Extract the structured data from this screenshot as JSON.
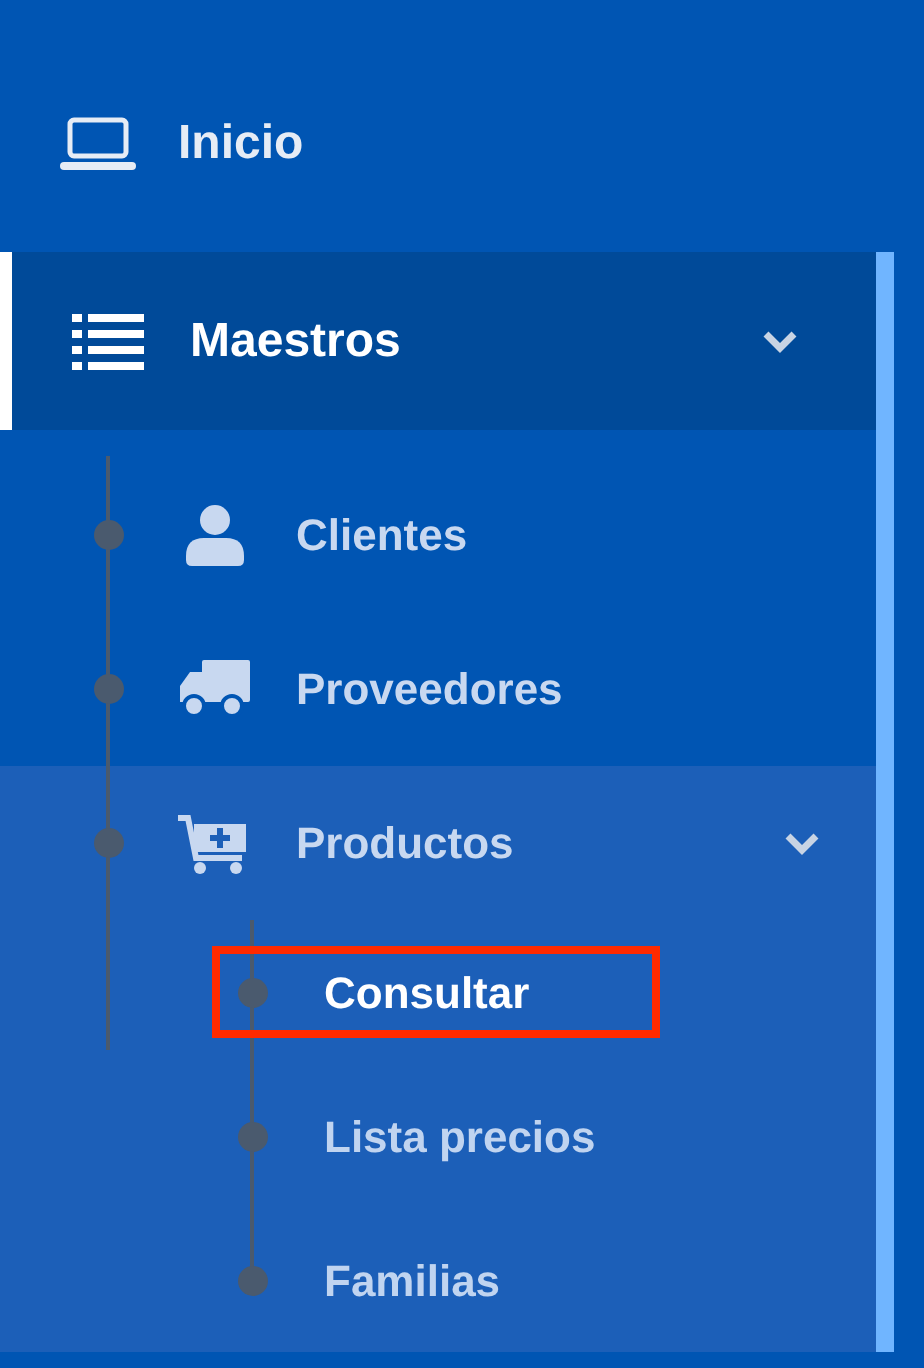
{
  "menu": [
    {
      "label": "Inicio",
      "kind": "link",
      "selected": false
    },
    {
      "label": "Maestros",
      "kind": "group",
      "selected": true,
      "expanded": true,
      "children": [
        {
          "label": "Clientes",
          "selected": false
        },
        {
          "label": "Proveedores",
          "selected": false
        },
        {
          "label": "Productos",
          "selected": false,
          "expanded": true,
          "children": [
            {
              "label": "Consultar",
              "selected": true,
              "highlighted": true
            },
            {
              "label": "Lista precios",
              "selected": false,
              "highlighted": false
            },
            {
              "label": "Familias",
              "selected": false,
              "highlighted": false
            }
          ]
        }
      ]
    }
  ]
}
